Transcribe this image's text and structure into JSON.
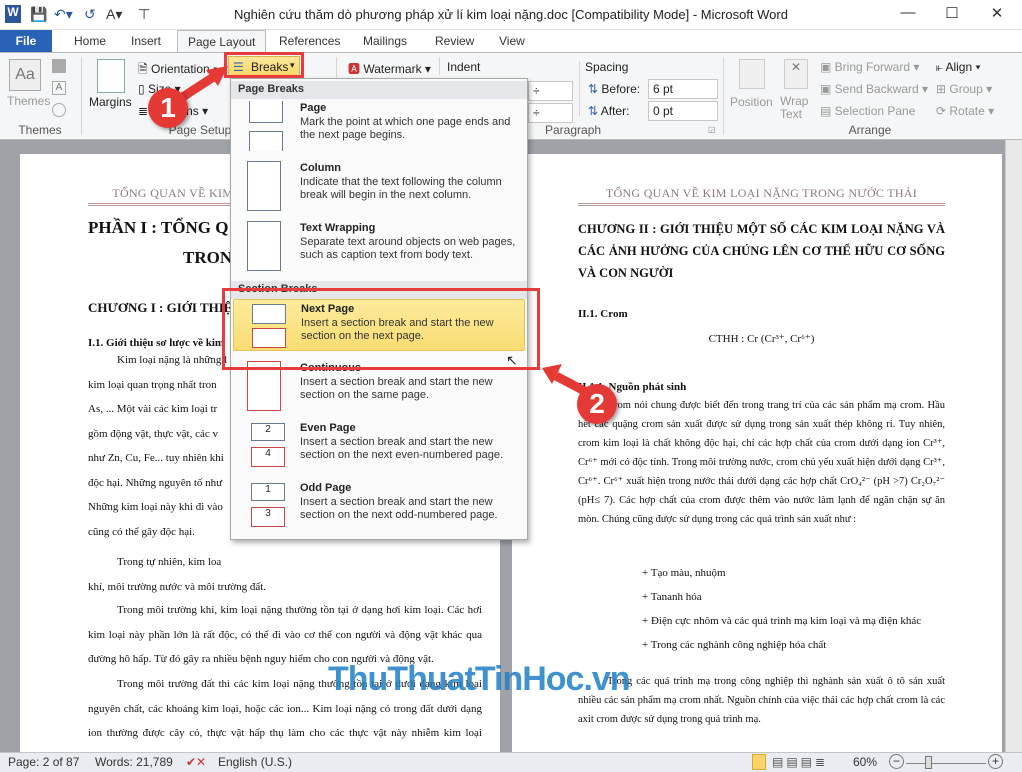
{
  "window": {
    "title": "Nghiên cứu thăm dò phương pháp xử lí kim loại nặng.doc [Compatibility Mode] - Microsoft Word"
  },
  "tabs": [
    "File",
    "Home",
    "Insert",
    "Page Layout",
    "References",
    "Mailings",
    "Review",
    "View"
  ],
  "ribbon": {
    "themes": {
      "label": "Themes",
      "group": "Themes"
    },
    "page_setup": {
      "margins": "Margins",
      "orientation": "Orientation",
      "size": "Size",
      "columns": "Columns",
      "breaks": "Breaks",
      "group": "Page Setup"
    },
    "background": {
      "watermark": "Watermark"
    },
    "paragraph": {
      "indent": "Indent",
      "spacing": "Spacing",
      "before_label": "Before:",
      "before_value": "6 pt",
      "after_label": "After:",
      "after_value": "0 pt",
      "group": "Paragraph"
    },
    "arrange": {
      "position": "Position",
      "wrap_text": "Wrap Text",
      "bring_forward": "Bring Forward",
      "send_backward": "Send Backward",
      "selection_pane": "Selection Pane",
      "align": "Align",
      "group_btn": "Group",
      "rotate": "Rotate",
      "group": "Arrange"
    }
  },
  "breaks_menu": {
    "page_breaks_header": "Page Breaks",
    "section_breaks_header": "Section Breaks",
    "items": [
      {
        "title": "Page",
        "desc": "Mark the point at which one page ends and the next page begins."
      },
      {
        "title": "Column",
        "desc": "Indicate that the text following the column break will begin in the next column."
      },
      {
        "title": "Text Wrapping",
        "desc": "Separate text around objects on web pages, such as caption text from body text."
      },
      {
        "title": "Next Page",
        "desc": "Insert a section break and start the new section on the next page.",
        "selected": true
      },
      {
        "title": "Continuous",
        "desc": "Insert a section break and start the new section on the same page."
      },
      {
        "title": "Even Page",
        "desc": "Insert a section break and start the new section on the next even-numbered page."
      },
      {
        "title": "Odd Page",
        "desc": "Insert a section break and start the new section on the next odd-numbered page."
      }
    ]
  },
  "annotations": {
    "step1": "1",
    "step2": "2",
    "highlight_color": "#e83b3b"
  },
  "left_page": {
    "header": "TỔNG QUAN VỀ KIM LOẠI NẶNG TRONG NƯỚC THẢI",
    "h1a": "PHẦN I : TỔNG Q",
    "h1b": "TRON",
    "h2": "CHƯƠNG I : GIỚI THIỆ",
    "h3": "I.1. Giới thiệu sơ lược về kim",
    "lines_partial": [
      "Kim loại nặng là những l",
      "kim loại quan trọng nhất tron",
      "As, ...  Một vài các kim loại tr",
      "gồm động vật, thực vật, các v",
      "như Zn, Cu, Fe... tuy nhiên khi",
      "độc hại. Những nguyên tố như",
      "Những kim loại này khi đi vào",
      "cũng có thể gây độc hại.",
      "Trong tự nhiên, kim loa",
      "khí, môi trường nước và môi trường đất."
    ],
    "paragraphs": [
      "Trong môi trường khí, kim loại nặng thường tồn tại ở dạng hơi kim loại. Các hơi kim loại này phần lớn là rất độc, có thể đi vào cơ thể con người và động vật khác qua đường hô hấp. Từ đó gây ra nhiều bệnh nguy hiểm cho con người và động vật.",
      "Trong môi trường đất thì các kim loại nặng thường tồn tại ở dưới dạng kim loại nguyên chất, các khoáng kim loại, hoặc các ion... Kim loại nặng có trong đất dưới dạng ion thường được cây cỏ, thực vật hấp thụ làm cho các thực vật này nhiễm kim loại nặng... Và nó có thể đi vào cơ thể con người và động vật thông qua đường tiêu hóa khi người và động vật tiêu thụ các loại thực vật này."
    ]
  },
  "right_page": {
    "header": "TỔNG QUAN VỀ KIM LOẠI NẶNG TRONG NƯỚC THẢI",
    "chapter": "CHƯƠNG II :   GIỚI THIỆU MỘT SỐ CÁC KIM LOẠI NẶNG VÀ CÁC ẢNH HƯỞNG CỦA CHÚNG LÊN CƠ THỂ HỮU CƠ SỐNG VÀ CON NGƯỜI",
    "section": "II.1. Crom",
    "formula": "CTHH : Cr (Cr³⁺, Cr⁶⁺)",
    "subsection": "II.1.1. Nguồn phát sinh",
    "para1": "Crom nói chung được biết đến  trong trang trí của các sản phẩm mạ crom. Hầu hết các quặng crom sản xuất được sử dụng trong sản xuất thép không rỉ. Tuy nhiên, crom kim loại là chất không độc hại, chỉ các hợp chất của crom dưới dạng ion Cr³⁺, Cr⁶⁺  mới có độc tính. Trong môi trường nước,  crom chủ yếu xuất hiện dưới dạng Cr³⁺, Cr⁶⁺. Cr⁶⁺ xuất hiện trong nước thải dưới dạng các hợp chất CrO₄²⁻ (pH >7) Cr₂O₇²⁻ (pH≤ 7). Các hợp chất của crom được thêm vào nước làm lạnh để ngăn chặn sự ăn mòn. Chúng cũng được sử dụng trong các quá trình sản xuất như :",
    "bullets": [
      "+ Tạo màu, nhuộm",
      "+ Tananh hóa",
      "+ Điện cực nhôm và các quá trình mạ kim loại và mạ điện khác",
      "+ Trong các nghành công nghiệp hóa chất"
    ],
    "para2": "Trong các quá trình mạ trong công nghiệp thì nghành sản xuất ô tô sản xuất nhiều các sản phẩm  mạ crom nhất. Nguồn chính của việc thải các hợp chất crom là các axit crom được sử dụng trong quá trình mạ."
  },
  "watermark": "ThuThuatTinHoc.vn",
  "status": {
    "page": "Page: 2 of 87",
    "words": "Words: 21,789",
    "language": "English (U.S.)",
    "zoom": "60%",
    "zoom_level": 60
  }
}
